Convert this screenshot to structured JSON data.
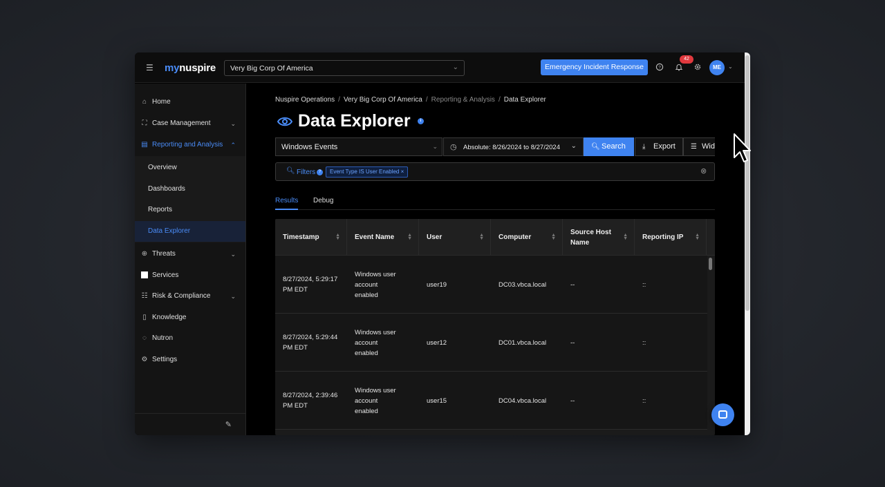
{
  "topbar": {
    "logo_my": "my",
    "logo_rest": "nuspire",
    "org_select_value": "Very Big Corp Of America",
    "emergency_button": "Emergency Incident Response",
    "notification_count": "42",
    "avatar_initials": "ME"
  },
  "sidebar": {
    "items": [
      {
        "label": "Home",
        "icon": "home-icon"
      },
      {
        "label": "Case Management",
        "icon": "case-icon"
      },
      {
        "label": "Reporting and Analysis",
        "icon": "chart-icon"
      },
      {
        "label": "Threats",
        "icon": "crosshair-icon"
      },
      {
        "label": "Services",
        "icon": "square-icon"
      },
      {
        "label": "Risk & Compliance",
        "icon": "list-icon"
      },
      {
        "label": "Knowledge",
        "icon": "book-icon"
      },
      {
        "label": "Nutron",
        "icon": "chat-icon"
      },
      {
        "label": "Settings",
        "icon": "gear-icon"
      }
    ],
    "subitems": [
      "Overview",
      "Dashboards",
      "Reports",
      "Data Explorer"
    ]
  },
  "breadcrumb": {
    "part1": "Nuspire Operations",
    "part2": "Very Big Corp Of America",
    "part3": "Reporting & Analysis",
    "part4": "Data Explorer"
  },
  "page": {
    "title": "Data Explorer"
  },
  "controls": {
    "source_value": "Windows Events",
    "date_range": "Absolute: 8/26/2024 to 8/27/2024",
    "search_label": "Search",
    "export_label": "Export",
    "widget_label": "Widget"
  },
  "filters": {
    "label": "Filters",
    "chip": "Event Type IS User Enabled ×"
  },
  "tabs": [
    "Results",
    "Debug"
  ],
  "table": {
    "columns": [
      "Timestamp",
      "Event Name",
      "User",
      "Computer",
      "Source Host Name",
      "Reporting IP"
    ],
    "rows": [
      {
        "timestamp": "8/27/2024, 5:29:17 PM EDT",
        "event": "Windows user account enabled",
        "user": "user19",
        "computer": "DC03.vbca.local",
        "source": "--",
        "ip": "::"
      },
      {
        "timestamp": "8/27/2024, 5:29:44 PM EDT",
        "event": "Windows user account enabled",
        "user": "user12",
        "computer": "DC01.vbca.local",
        "source": "--",
        "ip": "::"
      },
      {
        "timestamp": "8/27/2024, 2:39:46 PM EDT",
        "event": "Windows user account enabled",
        "user": "user15",
        "computer": "DC04.vbca.local",
        "source": "--",
        "ip": "::"
      }
    ]
  },
  "colors": {
    "accent": "#3f83f0",
    "badge": "#e0393e",
    "background": "#000000"
  }
}
